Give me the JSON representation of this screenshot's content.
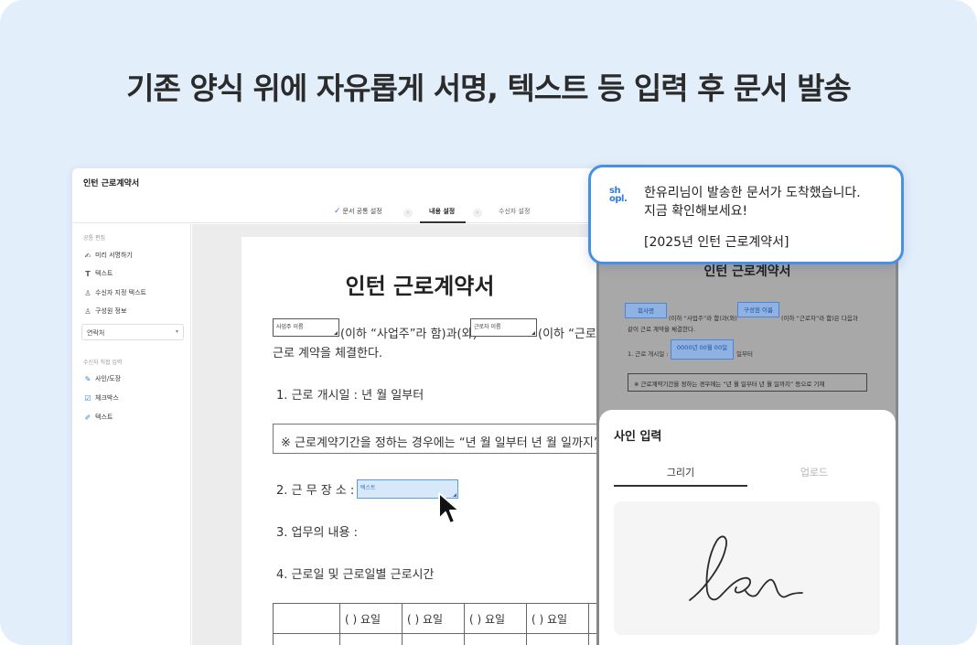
{
  "headline": "기존 양식 위에 자유롭게 서명, 텍스트 등 입력 후 문서 발송",
  "editor": {
    "title": "인턴 근로계약서",
    "steps": [
      {
        "label": "문서 공통 설정",
        "done": true
      },
      {
        "label": "내용 설정",
        "active": true
      },
      {
        "label": "수신자 설정"
      }
    ],
    "sidebar": {
      "section_common": "공통 편집",
      "common_items": [
        {
          "icon": "signature-icon",
          "label": "미리 서명하기"
        },
        {
          "icon": "text-icon",
          "label": "텍스트"
        },
        {
          "icon": "user-text-icon",
          "label": "수신자 지정 텍스트"
        },
        {
          "icon": "person-icon",
          "label": "구성원 정보"
        }
      ],
      "select_value": "연락처",
      "section_recipient": "수신자 직접 입력",
      "recipient_items": [
        {
          "icon": "stamp-icon",
          "label": "사인/도장"
        },
        {
          "icon": "checkbox-icon",
          "label": "체크박스"
        },
        {
          "icon": "pen-icon",
          "label": "텍스트"
        }
      ]
    },
    "document": {
      "title": "인턴 근로계약서",
      "field_employer": "사업주 이름",
      "field_worker": "근로자 이름",
      "line1_a": "(이하 “사업주”라 함)과(와)",
      "line1_b": "(이하 “근로",
      "line2": "근로 계약을 체결한다.",
      "item1": "1. 근로 개시일 :         년     월     일부터",
      "notice": "※ 근로계약기간을 정하는 경우에는 “년 월 일부터 년 월 일까지” 등으로 기재",
      "item2": "2. 근 무 장 소 :",
      "field_text": "텍스트",
      "item3": "3. 업무의 내용 :",
      "item4": "4. 근로일 및 근로일별 근로시간",
      "table_headers": [
        "(    ) 요일",
        "(    ) 요일",
        "(    ) 요일",
        "(    ) 요일"
      ]
    }
  },
  "phone": {
    "doc_title": "인턴 근로계약서",
    "field_company": "회사명",
    "field_member": "구성원 이름",
    "text_a": "(이하 “사업주”라 함)과(와)",
    "text_b": "(이하 “근로자”라 함)은 다음과",
    "text_c": "같이 근로 계약을 체결한다.",
    "item1_prefix": "1. 근로 개시일 :",
    "field_date": "0000년 00월 00일",
    "item1_suffix": "일부터",
    "notice": "※ 근로계약기간을 정하는 경우에는 “년 월 일부터 년 월 일까지” 등으로 기재",
    "sheet_title": "사인 입력",
    "tab_draw": "그리기",
    "tab_upload": "업로드"
  },
  "notification": {
    "logo_line1": "sh",
    "logo_line2": "opl.",
    "message_line1": "한유리님이 발송한 문서가 도착했습니다.",
    "message_line2": "지금 확인해보세요!",
    "document_name": "[2025년 인턴 근로계약서]"
  },
  "colors": {
    "background": "#e3eefb",
    "accent": "#2f7de1",
    "notification_border": "#4a90e2"
  }
}
